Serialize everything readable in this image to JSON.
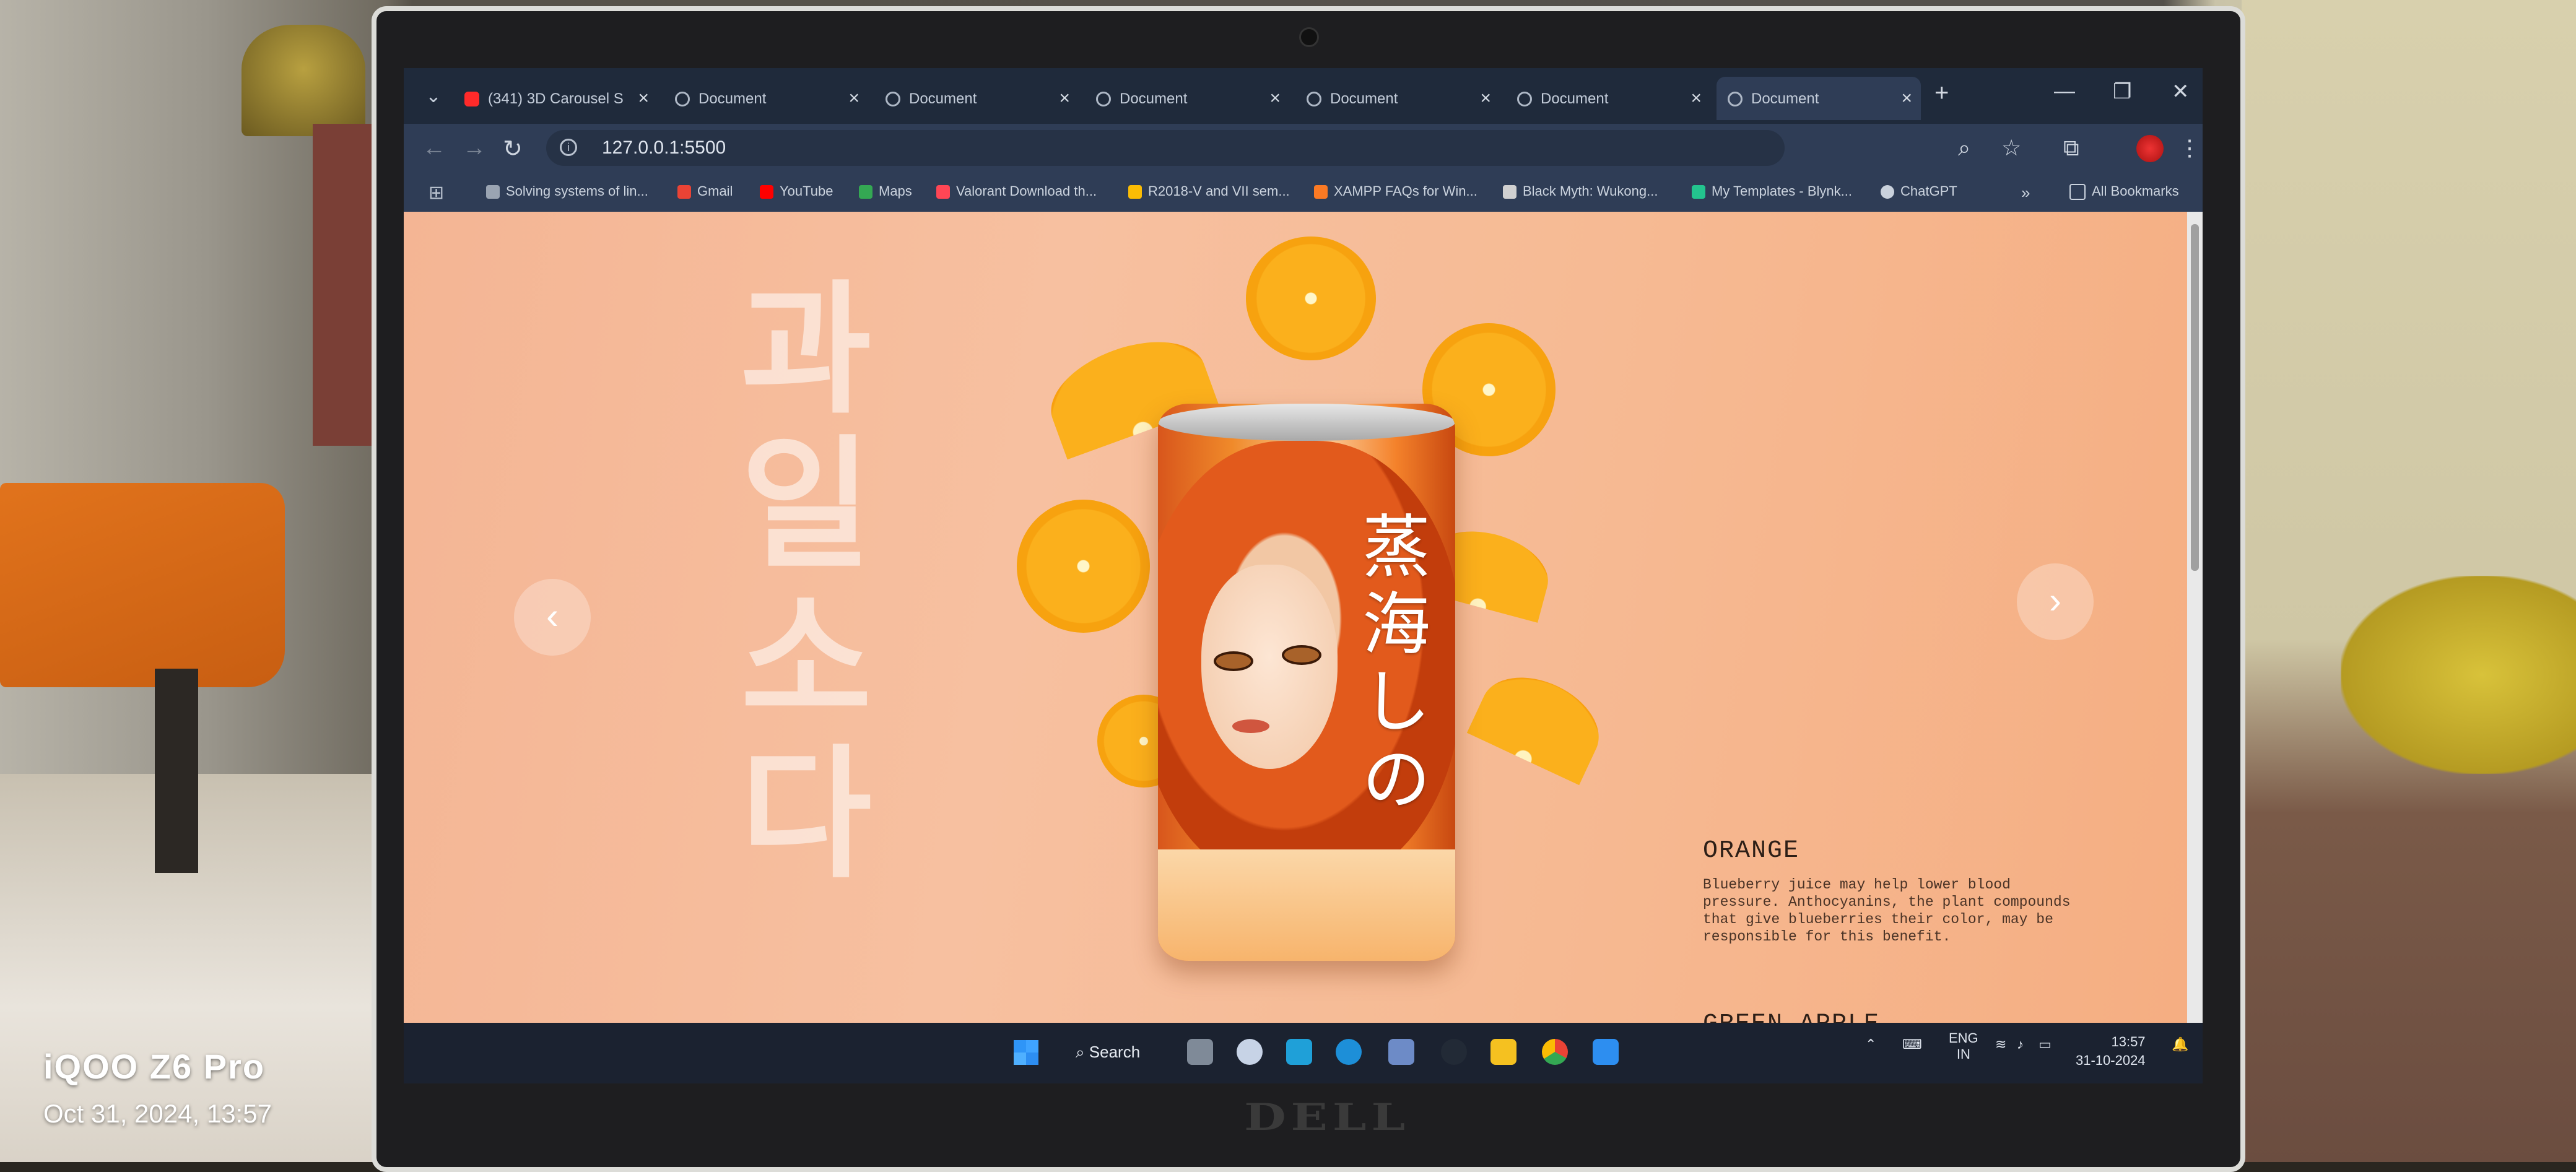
{
  "photo": {
    "watermark_brand": "iQOO Z6 Pro",
    "watermark_date": "Oct 31, 2024, 13:57",
    "laptop_brand": "DELL"
  },
  "browser": {
    "tabs": [
      {
        "label": "(341) 3D Carousel S",
        "icon": "youtube-icon",
        "active": false
      },
      {
        "label": "Document",
        "icon": "globe-icon",
        "active": false
      },
      {
        "label": "Document",
        "icon": "globe-icon",
        "active": false
      },
      {
        "label": "Document",
        "icon": "globe-icon",
        "active": false
      },
      {
        "label": "Document",
        "icon": "globe-icon",
        "active": false
      },
      {
        "label": "Document",
        "icon": "globe-icon",
        "active": false
      },
      {
        "label": "Document",
        "icon": "globe-icon",
        "active": true
      }
    ],
    "url": "127.0.0.1:5500",
    "bookmarks": [
      {
        "label": "Solving systems of lin...",
        "icon": "qr-icon",
        "color": "#9aa4b2"
      },
      {
        "label": "Gmail",
        "icon": "gmail-icon",
        "color": "#ea4335"
      },
      {
        "label": "YouTube",
        "icon": "youtube-icon",
        "color": "#ff0000"
      },
      {
        "label": "Maps",
        "icon": "maps-icon",
        "color": "#34a853"
      },
      {
        "label": "Valorant Download th...",
        "icon": "valorant-icon",
        "color": "#ff4655"
      },
      {
        "label": "R2018-V and VII sem...",
        "icon": "drive-icon",
        "color": "#fbbc04"
      },
      {
        "label": "XAMPP FAQs for Win...",
        "icon": "xampp-icon",
        "color": "#fb7a24"
      },
      {
        "label": "Black Myth: Wukong...",
        "icon": "wukong-icon",
        "color": "#d0d0d0"
      },
      {
        "label": "My Templates - Blynk...",
        "icon": "blynk-icon",
        "color": "#23c48e"
      },
      {
        "label": "ChatGPT",
        "icon": "chatgpt-icon",
        "color": "#c9d1dc"
      }
    ],
    "all_bookmarks": "All Bookmarks"
  },
  "page": {
    "korean_title": "과일소다",
    "can_text": "蒸海しの",
    "caption_title": "ORANGE",
    "caption_body": "Blueberry juice may help lower blood pressure. Anthocyanins, the plant compounds that give blueberries their color, may be responsible for this benefit.",
    "next_title": "GREEN APPLE"
  },
  "taskbar": {
    "search_label": "Search",
    "lang_top": "ENG",
    "lang_bottom": "IN",
    "time": "13:57",
    "date": "31-10-2024"
  }
}
